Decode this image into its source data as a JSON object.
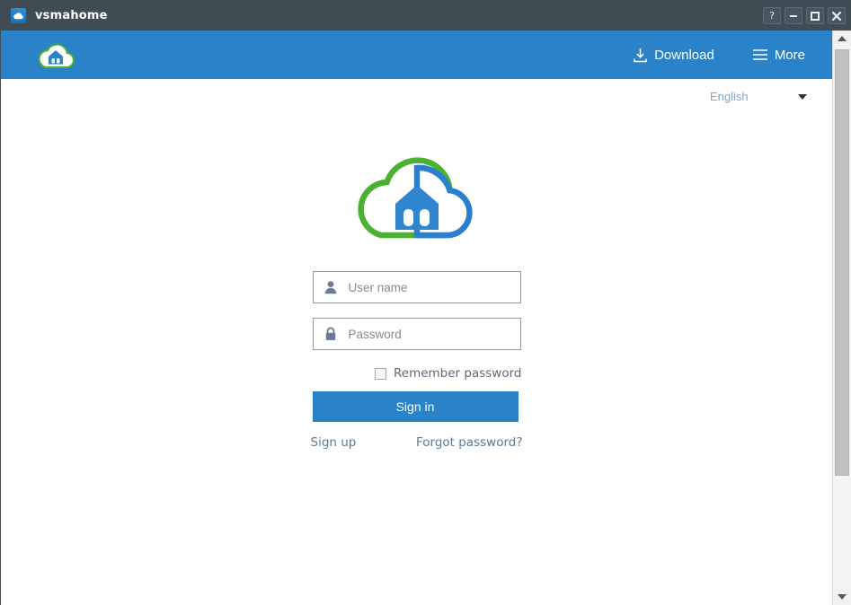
{
  "window": {
    "title": "vsmahome",
    "icon": "cloud-app-icon",
    "controls": [
      {
        "name": "help",
        "glyph": "?"
      },
      {
        "name": "minimize",
        "glyph": "minimize-icon"
      },
      {
        "name": "maximize",
        "glyph": "maximize-icon"
      },
      {
        "name": "close",
        "glyph": "close-icon"
      }
    ]
  },
  "header": {
    "logo": "cloud-house-logo",
    "accent_color": "#2a82c9",
    "actions": [
      {
        "label": "Download",
        "icon": "download-icon"
      },
      {
        "label": "More",
        "icon": "hamburger-menu-icon"
      }
    ]
  },
  "language": {
    "selected": "English",
    "icon": "chevron-down-icon"
  },
  "login": {
    "logo": "cloud-house-logo-large",
    "username": {
      "value": "",
      "placeholder": "User name",
      "icon": "user-icon"
    },
    "password": {
      "value": "",
      "placeholder": "Password",
      "icon": "lock-icon"
    },
    "remember": {
      "label": "Remember password",
      "checked": false
    },
    "submit_label": "Sign in",
    "links": [
      {
        "label": "Sign up"
      },
      {
        "label": "Forgot password?"
      }
    ]
  },
  "scrollbar": {
    "up_icon": "scroll-up-arrow-icon",
    "down_icon": "scroll-down-arrow-icon"
  },
  "colors": {
    "titlebar": "#3f4c54",
    "brand_blue": "#2a82c9",
    "logo_green": "#4cb030",
    "link": "#5a7a95",
    "content_bg": "#ffffff"
  }
}
